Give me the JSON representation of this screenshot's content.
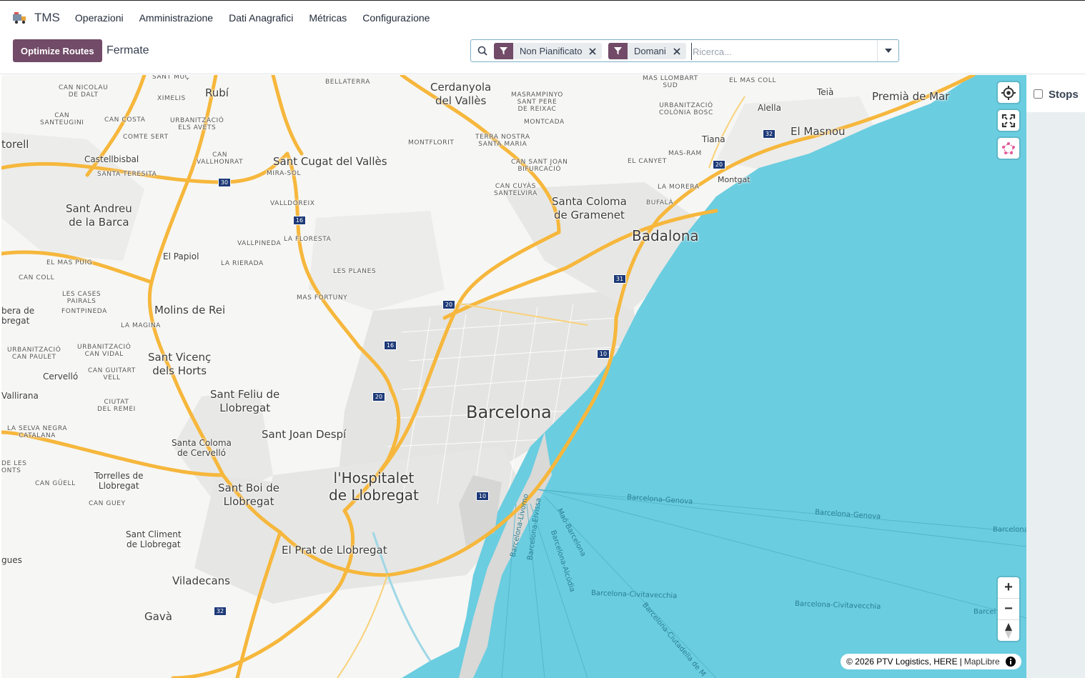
{
  "app": {
    "name": "TMS",
    "logo_icon": "truck-logo-icon"
  },
  "menu": [
    {
      "label": "Operazioni"
    },
    {
      "label": "Amministrazione"
    },
    {
      "label": "Dati Anagrafici"
    },
    {
      "label": "Métricas"
    },
    {
      "label": "Configurazione"
    }
  ],
  "toolbar": {
    "optimize_label": "Optimize Routes",
    "breadcrumb": "Fermate"
  },
  "search": {
    "facets": [
      {
        "label": "Non Pianificato"
      },
      {
        "label": "Domani"
      }
    ],
    "placeholder": "Ricerca...",
    "value": ""
  },
  "map": {
    "labels": {
      "cerdanyola": "Cerdanyola\ndel Vallès",
      "sant_cugat": "Sant Cugat del Vallès",
      "rubi": "Rubí",
      "sant_andreu": "Sant Andreu\nde la Barca",
      "molins": "Molins de Rei",
      "sant_vicenc": "Sant Vicenç\ndels Horts",
      "sant_feliu": "Sant Feliu de\nLlobregat",
      "sant_joan": "Sant Joan Despí",
      "hospitalet": "l'Hospitalet\nde Llobregat",
      "barcelona": "Barcelona",
      "badalona": "Badalona",
      "santa_coloma": "Santa Coloma\nde Gramenet",
      "el_masnou": "El Masnou",
      "premia": "Premià de Mar",
      "montgat": "Montgat",
      "tiana": "Tiana",
      "alella": "Alella",
      "teia": "Teià",
      "sant_boi": "Sant Boi de\nLlobregat",
      "el_prat": "El Prat de Llobregat",
      "viladecans": "Viladecans",
      "gava": "Gavà",
      "castellbisbal": "Castellbisbal",
      "el_papiol": "El Papiol",
      "cervello": "Cervelló",
      "vallirana": "Vallirana",
      "torrelles": "Torrelles de\nLlobregat",
      "santa_coloma_cervello": "Santa Coloma\nde Cervelló",
      "sant_climent": "Sant Climent\nde Llobregat",
      "torell": "torell",
      "abrera": "bera de\nbregat",
      "gues": "gues",
      "sant_muc": "SANT MUÇ",
      "bellaterra": "BELLATERRA",
      "mas_llombart": "MAS LLOMBART\nSUD",
      "el_mas_coll": "EL MAS COLL",
      "can_nicolau": "CAN NICOLAU\nDE DALT",
      "xirmelis": "XIMELIS",
      "masrampinyo": "MASRAMPINYO\nSANT PERE\nDE REIXAC",
      "montcada": "MONTCADA",
      "urbanitzacio_colonia": "URBANITZACIÓ\nCOLÒNIA BOSC",
      "can_santeugini": "CAN\nSANTEUGINI",
      "can_costa": "CAN COSTA",
      "urb_els_avets": "URBANITZACIÓ\nELS AVETS",
      "comte_sert": "COMTE SERT",
      "terra_nostra": "TERRA NOSTRA\nSANTA MARIA",
      "montflorit": "MONTFLORIT",
      "can_vallhonrat": "CAN\nVALLHONRAT",
      "mira_sol": "MIRA-SOL",
      "can_sant_joan": "CAN SANT JOAN\nBIFURCACIÓ",
      "el_canyet": "EL CANYET",
      "mas_ram": "MAS-RAM",
      "santa_teresita": "SANTA TERESITA",
      "la_morera": "LA MORERA",
      "can_cuyas": "CAN CUYÀS\nSANTELVIRA",
      "bufala": "BUFALÀ",
      "valldoreix": "VALLDOREIX",
      "la_floresta": "LA FLORESTA",
      "vallpineda": "VALLPINEDA",
      "el_mas_puig": "EL MAS PUIG",
      "la_rierada": "LA RIERADA",
      "les_planes": "LES PLANES",
      "can_coll": "CAN COLL",
      "les_cases": "LES CASES\nPAIRALS",
      "fontpineda": "FONTPINEDA",
      "mas_fortuny": "MAS FORTUNY",
      "la_magina": "LA MAGINA",
      "urb_can_paulet": "URBANITZACIÓ\nCAN PAULET",
      "urb_can_vidal": "URBANITZACIÓ\nCAN VIDAL",
      "can_guitart": "CAN GUITART\nVELL",
      "ciutat_remei": "CIUTAT\nDEL REMEI",
      "la_selva": "LA SELVA NEGRA\nCATALANA",
      "de_les_fonts": "DE LES\nONTS",
      "can_guell": "CAN GÜELL",
      "can_guey": "CAN GUEY"
    },
    "sea_routes": {
      "genova1": "Barcelona-Genova",
      "genova2": "Barcelona-Genova",
      "barcelona_r": "Barcelona",
      "civita1": "Barcelona-Civitavecchia",
      "civita2": "Barcelona-Civitavecchia",
      "barcel_r": "Barcel",
      "livorno": "Barcelona-Livorno",
      "eivissa": "Barcelona-Eivissa",
      "mao": "Maó-Barcelona",
      "alcudia": "Barcelona-Alcúdia",
      "ciutadella": "Barcelona-Ciutadella de M"
    },
    "shields": [
      "30",
      "16",
      "20",
      "16",
      "20",
      "10",
      "31",
      "10",
      "20",
      "32",
      "32"
    ],
    "controls": {
      "locate_icon": "crosshair-icon",
      "fullscreen_icon": "fullscreen-icon",
      "draw_icon": "polygon-draw-icon",
      "zoom_in": "+",
      "zoom_out": "−",
      "compass_icon": "compass-icon"
    },
    "attribution": {
      "text": "© 2026 PTV Logistics, HERE",
      "separator": "|",
      "maplibre": "MapLibre"
    }
  },
  "side_panel": {
    "stops_label": "Stops",
    "stops_checked": false
  },
  "colors": {
    "brand": "#714b67",
    "sea": "#6acde0",
    "highway": "#f6b73c",
    "shield": "#1e3a78"
  }
}
